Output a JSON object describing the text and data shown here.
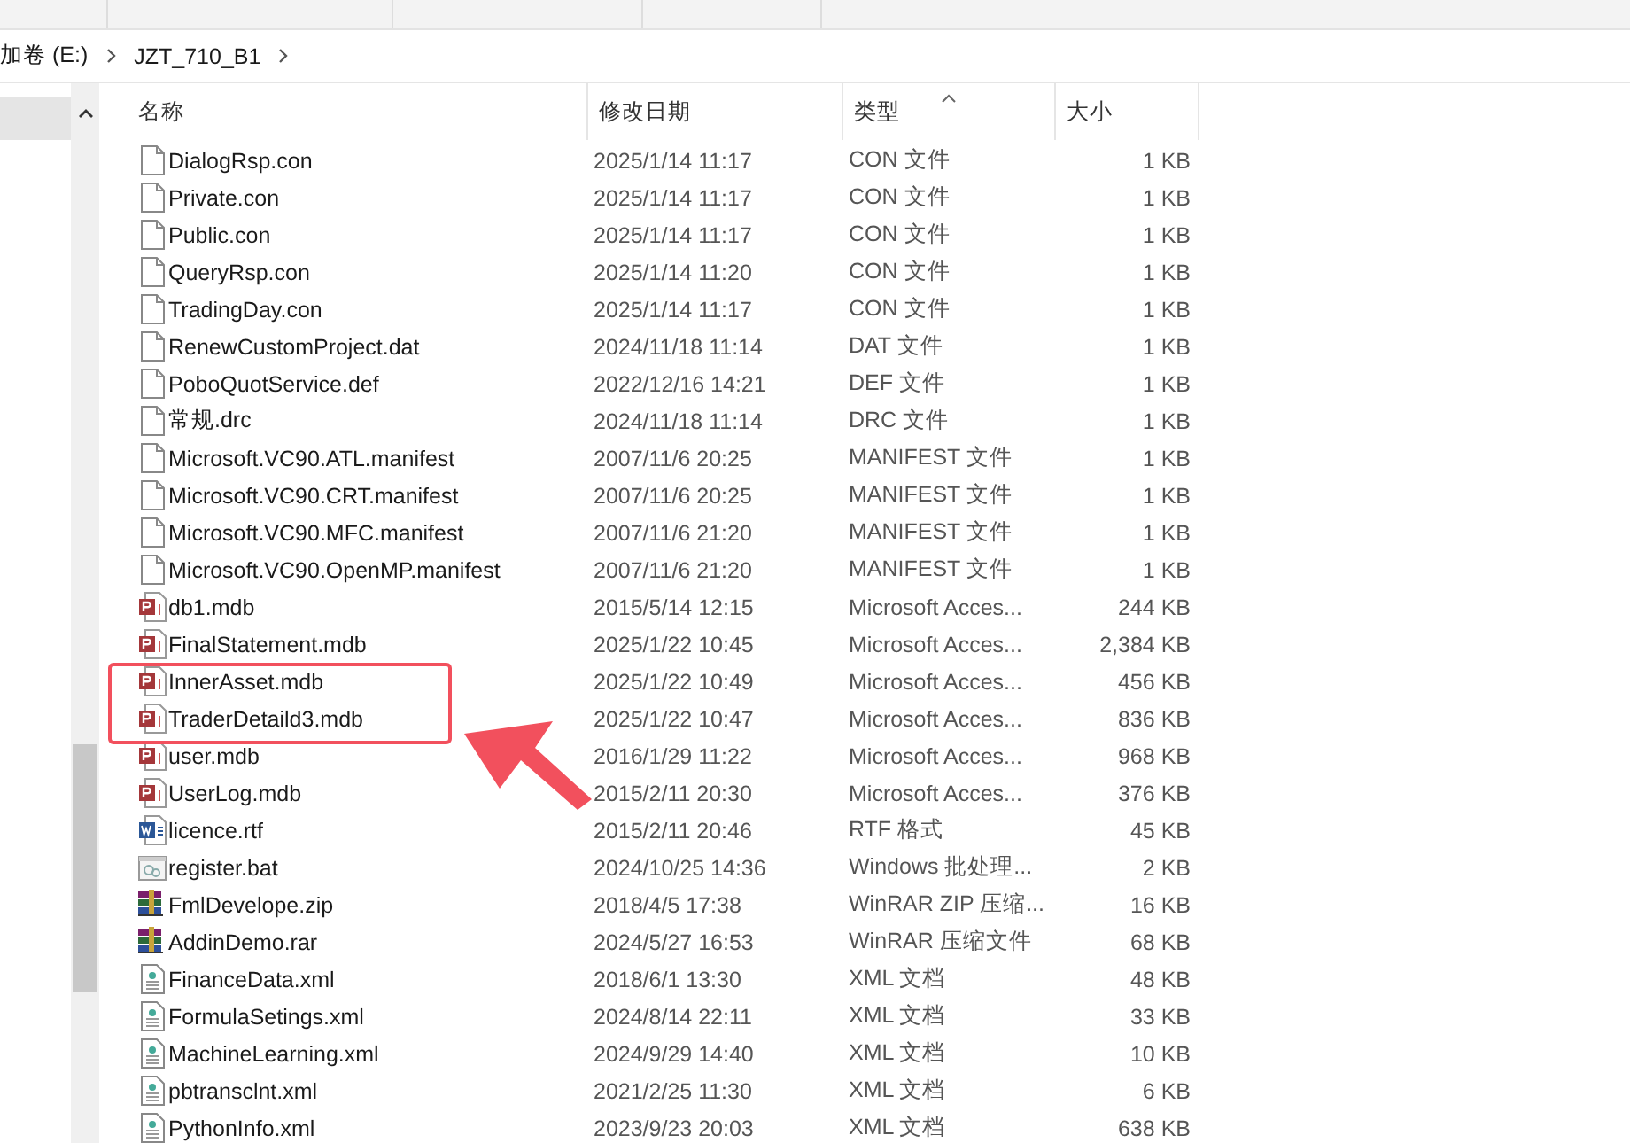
{
  "breadcrumb": [
    "加卷 (E:)",
    "JZT_710_B1"
  ],
  "columns": [
    "名称",
    "修改日期",
    "类型",
    "大小"
  ],
  "files": [
    {
      "kind": "blank",
      "name": "DialogRsp.con",
      "date": "2025/1/14 11:17",
      "type": "CON 文件",
      "size": "1 KB"
    },
    {
      "kind": "blank",
      "name": "Private.con",
      "date": "2025/1/14 11:17",
      "type": "CON 文件",
      "size": "1 KB"
    },
    {
      "kind": "blank",
      "name": "Public.con",
      "date": "2025/1/14 11:17",
      "type": "CON 文件",
      "size": "1 KB"
    },
    {
      "kind": "blank",
      "name": "QueryRsp.con",
      "date": "2025/1/14 11:20",
      "type": "CON 文件",
      "size": "1 KB"
    },
    {
      "kind": "blank",
      "name": "TradingDay.con",
      "date": "2025/1/14 11:17",
      "type": "CON 文件",
      "size": "1 KB"
    },
    {
      "kind": "blank",
      "name": "RenewCustomProject.dat",
      "date": "2024/11/18 11:14",
      "type": "DAT 文件",
      "size": "1 KB"
    },
    {
      "kind": "blank",
      "name": "PoboQuotService.def",
      "date": "2022/12/16 14:21",
      "type": "DEF 文件",
      "size": "1 KB"
    },
    {
      "kind": "blank",
      "name": "常规.drc",
      "date": "2024/11/18 11:14",
      "type": "DRC 文件",
      "size": "1 KB"
    },
    {
      "kind": "blank",
      "name": "Microsoft.VC90.ATL.manifest",
      "date": "2007/11/6 20:25",
      "type": "MANIFEST 文件",
      "size": "1 KB"
    },
    {
      "kind": "blank",
      "name": "Microsoft.VC90.CRT.manifest",
      "date": "2007/11/6 20:25",
      "type": "MANIFEST 文件",
      "size": "1 KB"
    },
    {
      "kind": "blank",
      "name": "Microsoft.VC90.MFC.manifest",
      "date": "2007/11/6 21:20",
      "type": "MANIFEST 文件",
      "size": "1 KB"
    },
    {
      "kind": "blank",
      "name": "Microsoft.VC90.OpenMP.manifest",
      "date": "2007/11/6 21:20",
      "type": "MANIFEST 文件",
      "size": "1 KB"
    },
    {
      "kind": "access",
      "name": "db1.mdb",
      "date": "2015/5/14 12:15",
      "type": "Microsoft Acces...",
      "size": "244 KB"
    },
    {
      "kind": "access",
      "name": "FinalStatement.mdb",
      "date": "2025/1/22 10:45",
      "type": "Microsoft Acces...",
      "size": "2,384 KB"
    },
    {
      "kind": "access",
      "name": "InnerAsset.mdb",
      "date": "2025/1/22 10:49",
      "type": "Microsoft Acces...",
      "size": "456 KB"
    },
    {
      "kind": "access",
      "name": "TraderDetaild3.mdb",
      "date": "2025/1/22 10:47",
      "type": "Microsoft Acces...",
      "size": "836 KB"
    },
    {
      "kind": "access",
      "name": "user.mdb",
      "date": "2016/1/29 11:22",
      "type": "Microsoft Acces...",
      "size": "968 KB"
    },
    {
      "kind": "access",
      "name": "UserLog.mdb",
      "date": "2015/2/11 20:30",
      "type": "Microsoft Acces...",
      "size": "376 KB"
    },
    {
      "kind": "word",
      "name": "licence.rtf",
      "date": "2015/2/11 20:46",
      "type": "RTF 格式",
      "size": "45 KB"
    },
    {
      "kind": "batch",
      "name": "register.bat",
      "date": "2024/10/25 14:36",
      "type": "Windows 批处理...",
      "size": "2 KB"
    },
    {
      "kind": "archive",
      "name": "FmlDevelope.zip",
      "date": "2018/4/5 17:38",
      "type": "WinRAR ZIP 压缩...",
      "size": "16 KB"
    },
    {
      "kind": "archive",
      "name": "AddinDemo.rar",
      "date": "2024/5/27 16:53",
      "type": "WinRAR 压缩文件",
      "size": "68 KB"
    },
    {
      "kind": "xml",
      "name": "FinanceData.xml",
      "date": "2018/6/1 13:30",
      "type": "XML 文档",
      "size": "48 KB"
    },
    {
      "kind": "xml",
      "name": "FormulaSetings.xml",
      "date": "2024/8/14 22:11",
      "type": "XML 文档",
      "size": "33 KB"
    },
    {
      "kind": "xml",
      "name": "MachineLearning.xml",
      "date": "2024/9/29 14:40",
      "type": "XML 文档",
      "size": "10 KB"
    },
    {
      "kind": "xml",
      "name": "pbtransclnt.xml",
      "date": "2021/2/25 11:30",
      "type": "XML 文档",
      "size": "6 KB"
    },
    {
      "kind": "xml",
      "name": "PythonInfo.xml",
      "date": "2023/9/23 20:03",
      "type": "XML 文档",
      "size": "638 KB"
    }
  ]
}
